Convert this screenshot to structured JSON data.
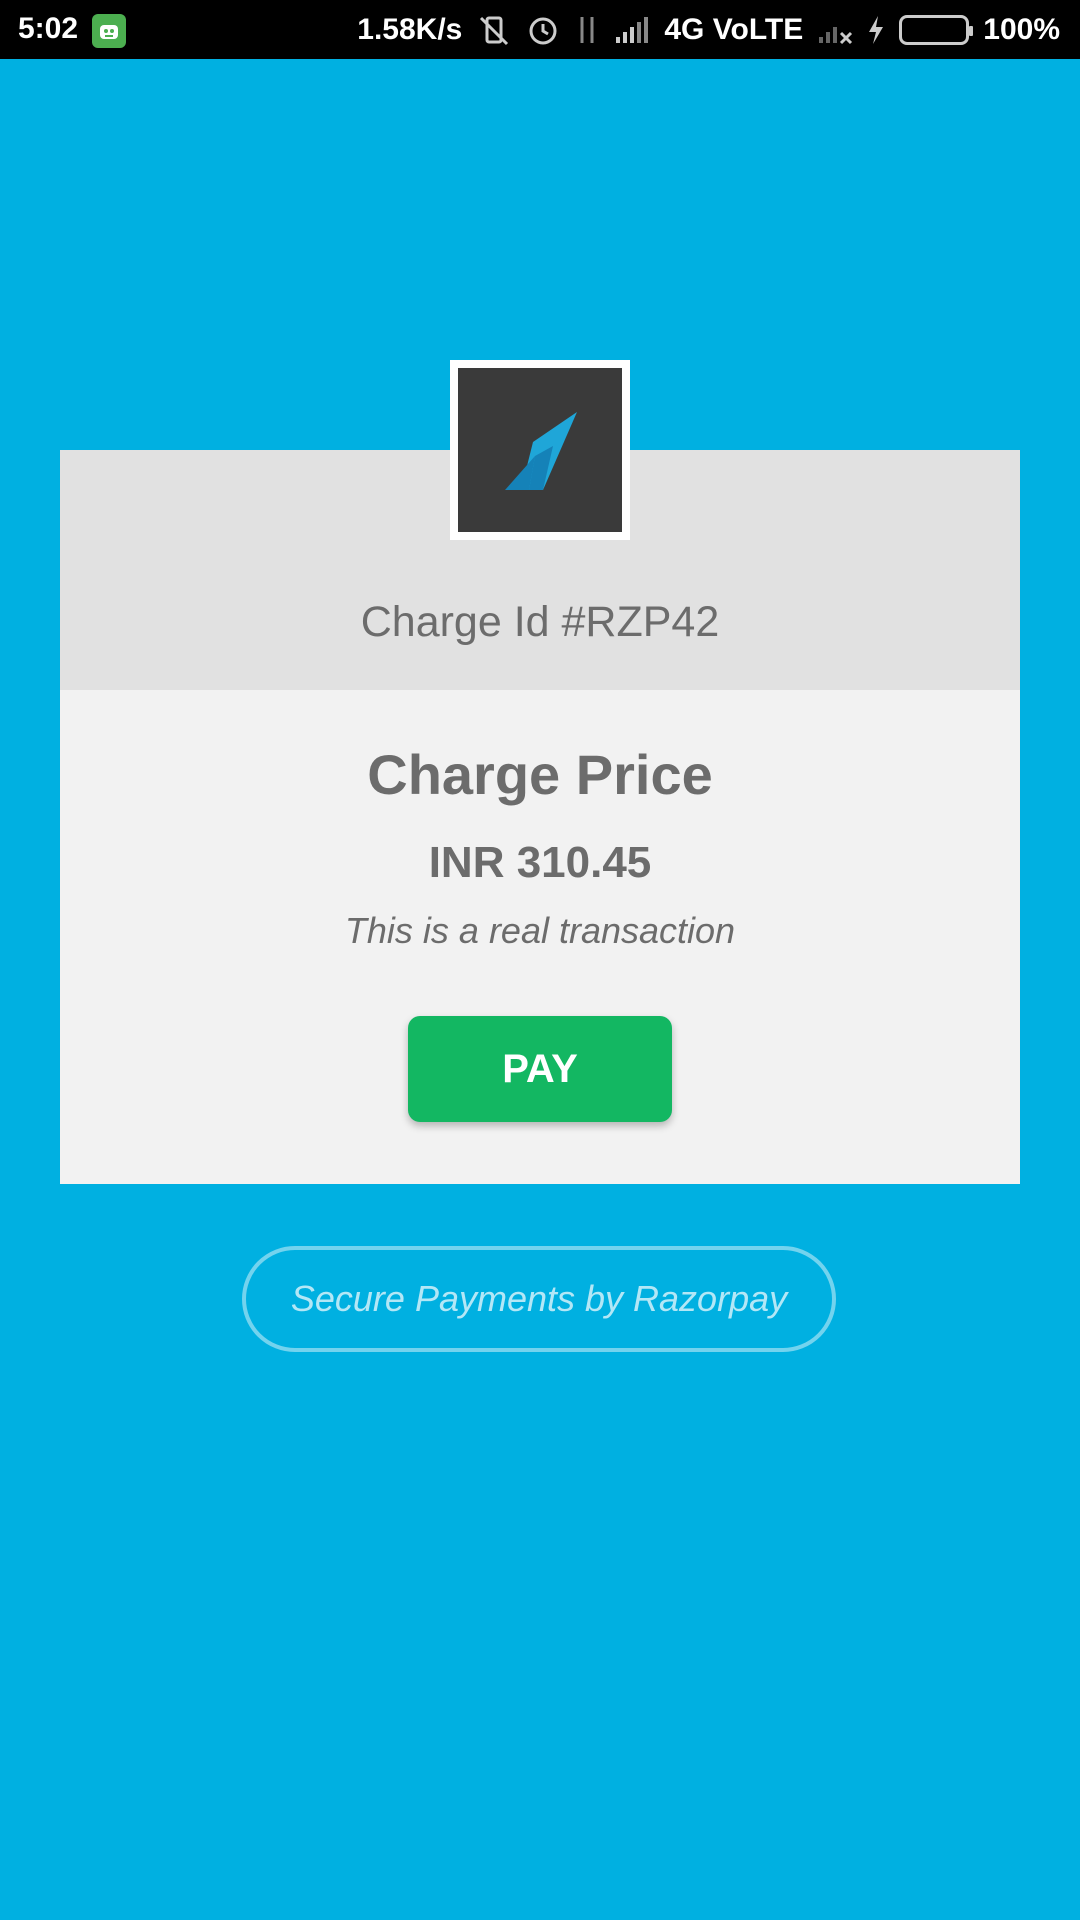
{
  "status_bar": {
    "time": "5:02",
    "network_speed": "1.58K/s",
    "network_type": "4G VoLTE",
    "battery_percent": "100%",
    "icons": [
      "app-notification-icon",
      "vibrate-off-icon",
      "alarm-icon",
      "data-transfer-icon",
      "signal-icon",
      "no-signal-icon",
      "charging-icon",
      "battery-icon"
    ]
  },
  "colors": {
    "background": "#00b0e1",
    "card_header": "#e1e1e1",
    "card_body": "#f2f2f2",
    "pay_button": "#13b762",
    "text": "#6c6c6c"
  },
  "merchant": {
    "logo_icon": "razorpay-logo-icon"
  },
  "charge": {
    "id_label": "Charge Id #RZP42",
    "price_title": "Charge Price",
    "amount": "INR 310.45",
    "note": "This is a real transaction"
  },
  "actions": {
    "pay_label": "PAY"
  },
  "footer": {
    "secure_text": "Secure Payments by Razorpay"
  }
}
